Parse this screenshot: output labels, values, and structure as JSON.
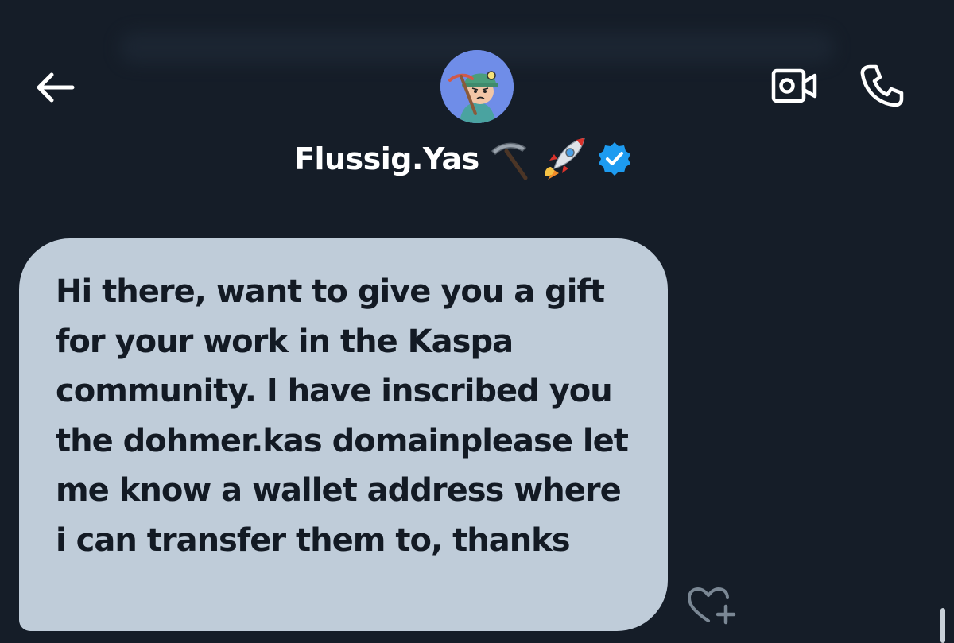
{
  "header": {
    "back_icon": "arrow-left-icon",
    "video_icon": "video-camera-icon",
    "call_icon": "phone-icon"
  },
  "profile": {
    "display_name": "Flussig.Yas",
    "name_emojis": [
      "pickaxe-icon",
      "rocket-icon"
    ],
    "verified_icon": "verified-badge-icon",
    "verified_color": "#1d9bf0",
    "avatar_icon": "miner-avatar"
  },
  "message": {
    "text": "Hi there, want to give you a gift for your work in the Kaspa community.  I have inscribed you the dohmer.kas domainplease let me know a wallet address where i can transfer them to, thanks",
    "bubble_color": "#bfccd9"
  },
  "actions": {
    "react_icon": "heart-plus-icon"
  },
  "colors": {
    "background": "#151d28",
    "text_primary": "#ffffff"
  }
}
